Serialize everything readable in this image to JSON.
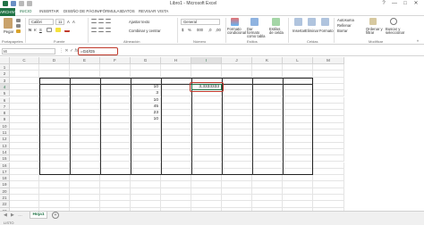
{
  "window": {
    "title": "Libro1 - Microsoft Excel",
    "controls": [
      "?",
      "—",
      "□",
      "✕"
    ]
  },
  "tabs": [
    "ARCHIVO",
    "INICIO",
    "INSERTAR",
    "DISEÑO DE PÁGINA",
    "FÓRMULAS",
    "DATOS",
    "REVISAR",
    "VISTA"
  ],
  "ribbon": {
    "paste": "Pegar",
    "font_name": "Calibri",
    "font_size": "11",
    "wrap_text": "Ajustar texto",
    "merge_center": "Combinar y centrar",
    "number_format": "General",
    "cond_format": "Formato condicional",
    "table_format": "Dar formato como tabla",
    "cell_styles": "Estilos de celda",
    "insert": "Insertar",
    "delete": "Eliminar",
    "format": "Formato",
    "autosum": "Autosuma",
    "fill": "Rellenar",
    "clear": "Borrar",
    "sort": "Ordenar y filtrar",
    "find": "Buscar y seleccionar",
    "groups": [
      "Portapapeles",
      "Fuente",
      "Alineación",
      "Número",
      "Estilos",
      "Celdas",
      "Modificar"
    ]
  },
  "formula_bar": {
    "namebox": "I4",
    "formula": "=G4/G5"
  },
  "columns": [
    "C",
    "D",
    "E",
    "F",
    "G",
    "H",
    "I",
    "J",
    "K",
    "L",
    "M"
  ],
  "rows": [
    "1",
    "2",
    "3",
    "4",
    "5",
    "6",
    "7",
    "8",
    "9",
    "10",
    "11",
    "12",
    "13",
    "14",
    "15",
    "16",
    "17",
    "18",
    "19",
    "20",
    "21",
    "22",
    "23"
  ],
  "values": {
    "G4": "10",
    "G5": "3",
    "G6": "10",
    "G7": "45",
    "G8": "23",
    "G9": "10",
    "I4": "3,3333333"
  },
  "sheet": {
    "tab": "Hoja1",
    "status": "LISTO"
  },
  "colors": {
    "accent": "#217346",
    "highlight": "#c0392b"
  }
}
